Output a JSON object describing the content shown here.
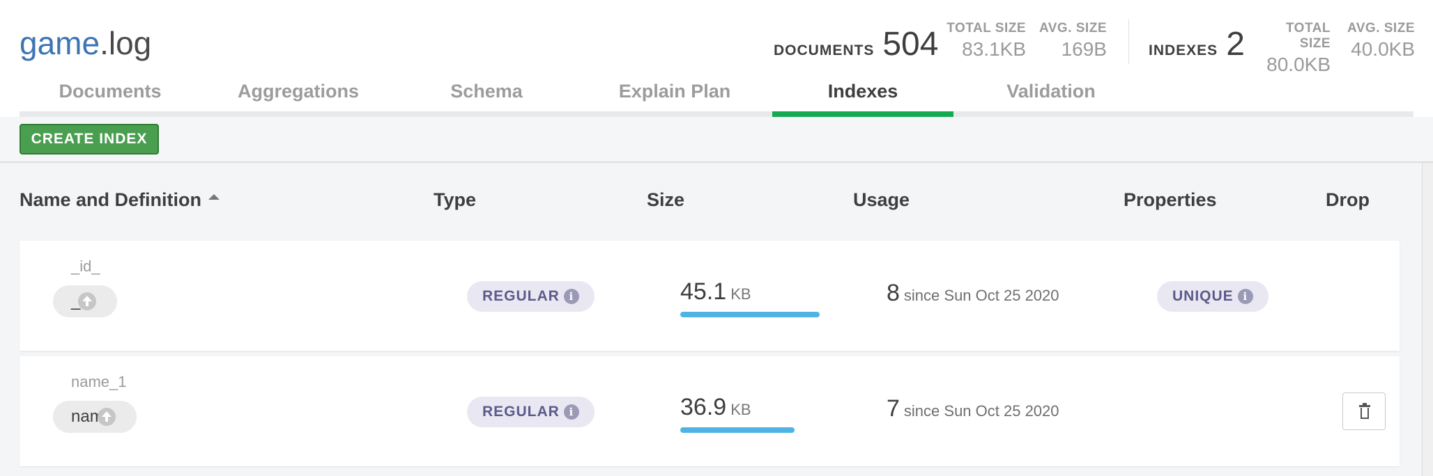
{
  "header": {
    "db_name": "game",
    "coll_name": ".log",
    "documents": {
      "label": "DOCUMENTS",
      "value": "504",
      "total_size_label": "TOTAL SIZE",
      "total_size": "83.1KB",
      "avg_size_label": "AVG. SIZE",
      "avg_size": "169B"
    },
    "indexes": {
      "label": "INDEXES",
      "value": "2",
      "total_size_label": "TOTAL SIZE",
      "total_size": "80.0KB",
      "avg_size_label": "AVG. SIZE",
      "avg_size": "40.0KB"
    }
  },
  "tabs": [
    "Documents",
    "Aggregations",
    "Schema",
    "Explain Plan",
    "Indexes",
    "Validation"
  ],
  "active_tab": "Indexes",
  "toolbar": {
    "create_index_label": "CREATE INDEX"
  },
  "table": {
    "columns": {
      "name": "Name and Definition",
      "type": "Type",
      "size": "Size",
      "usage": "Usage",
      "properties": "Properties",
      "drop": "Drop"
    },
    "rows": [
      {
        "name": "_id_",
        "field": "_id",
        "type": "REGULAR",
        "size": "45.1",
        "size_unit": "KB",
        "size_fraction": 1.0,
        "usage": "8",
        "since": "since Sun Oct 25 2020",
        "property": "UNIQUE",
        "droppable": false
      },
      {
        "name": "name_1",
        "field": "name",
        "type": "REGULAR",
        "size": "36.9",
        "size_unit": "KB",
        "size_fraction": 0.82,
        "usage": "7",
        "since": "since Sun Oct 25 2020",
        "property": "",
        "droppable": true
      }
    ]
  },
  "colors": {
    "accent_green": "#13aa52",
    "button_green": "#4a9e4f",
    "size_bar": "#4fb4e4",
    "db_blue": "#3d74b4"
  },
  "icons": {
    "sort": "sort-ascending-icon",
    "direction": "arrow-up-circle-icon",
    "info": "info-icon",
    "drop": "trash-icon"
  }
}
